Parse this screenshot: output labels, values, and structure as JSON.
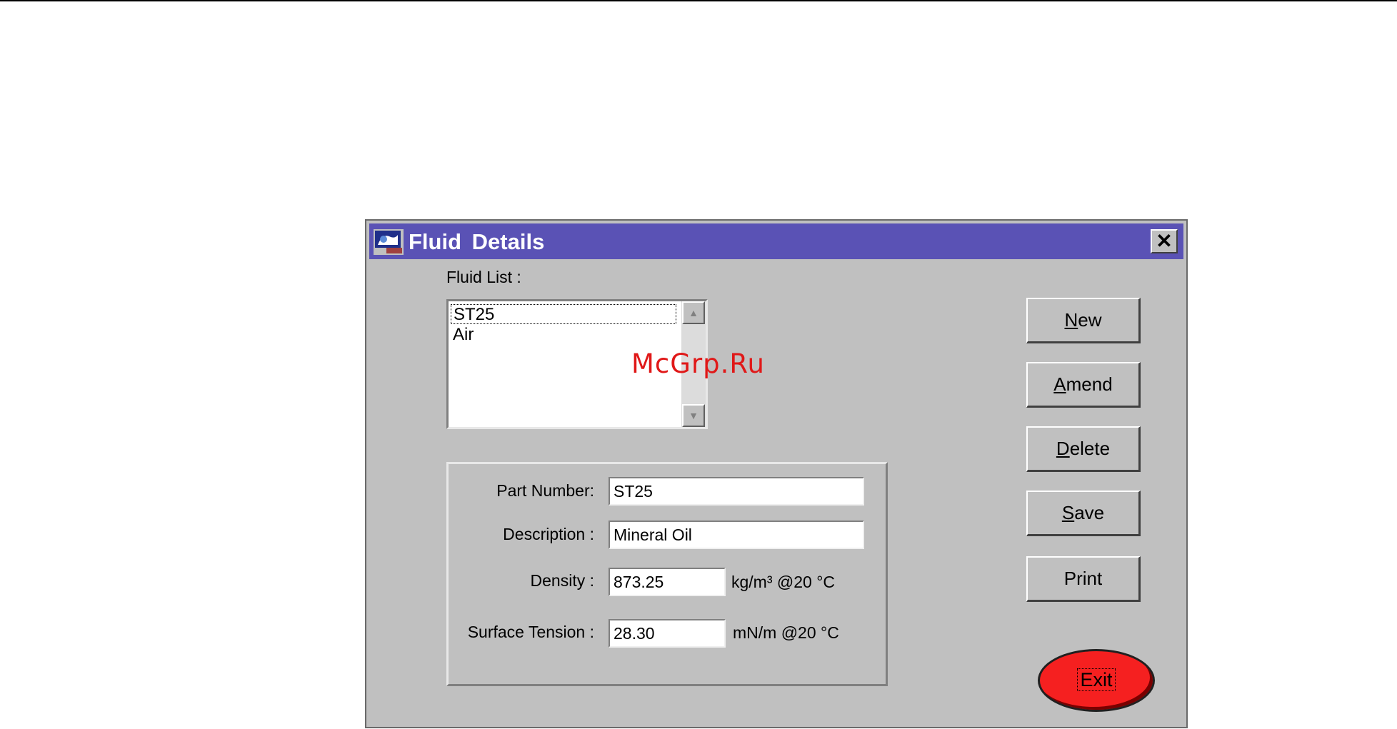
{
  "window": {
    "title": "Fluid  Details",
    "close_glyph": "✕",
    "icon": "app-icon"
  },
  "fluid_list": {
    "label": "Fluid  List :",
    "items": [
      "ST25",
      "Air"
    ],
    "selected": "ST25"
  },
  "form": {
    "part_number_label": "Part Number:",
    "part_number_value": "ST25",
    "description_label": "Description :",
    "description_value": "Mineral Oil",
    "density_label": "Density :",
    "density_value": "873.25",
    "density_unit": "kg/m³  @20 °C",
    "surface_tension_label": "Surface Tension :",
    "surface_tension_value": "28.30",
    "surface_tension_unit": "mN/m  @20 °C"
  },
  "buttons": {
    "new": "New",
    "amend": "Amend",
    "delete": "Delete",
    "save": "Save",
    "print": "Print",
    "exit": "Exit"
  },
  "watermark": "McGrp.Ru",
  "colors": {
    "titlebar": "#5a52b5",
    "window_bg": "#c0c0c0",
    "exit_button": "#f52020",
    "watermark": "#e01818"
  }
}
